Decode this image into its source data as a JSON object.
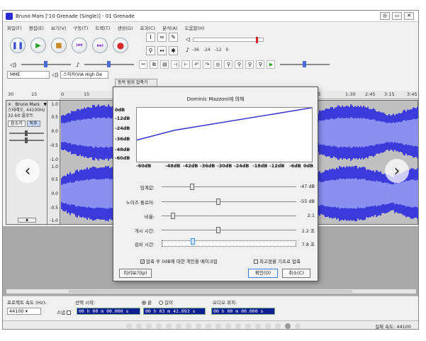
{
  "window": {
    "title": "Bruno Mars ['10 Grenade (Single)] - 01 Grenade",
    "controls": [
      "◎",
      "▭",
      "✕"
    ]
  },
  "menu": [
    "파일(F)",
    "편집(E)",
    "보기(V)",
    "구동(T)",
    "트랙(T)",
    "생성(G)",
    "효과(C)",
    "분석(A)",
    "도움말(H)"
  ],
  "meter_scale": [
    "-36",
    "-24",
    "-12",
    "0"
  ],
  "device_bar": {
    "host": "MME",
    "output": "스피커(VIA High De"
  },
  "timeline": {
    "labels": [
      "30",
      "15",
      "0",
      "15",
      "45",
      "1:30",
      "2:45",
      "3:15",
      "3:45"
    ]
  },
  "track": {
    "name": "Bruno Mars",
    "info_line1": "스테레오, 44100Hz",
    "info_line2": "32-bit 플로트",
    "mute": "음소거",
    "solo": "독주",
    "scale_top": [
      "1.0",
      "0.5",
      "0.0",
      "-0.5",
      "-1.0"
    ],
    "scale_bot": [
      "1.0",
      "0.5",
      "0.0",
      "-0.5",
      "-1.0"
    ]
  },
  "dialog": {
    "tab": "동적 범위 압축기",
    "subtitle": "Dominic Mazzoni에 의해",
    "curve_y_labels": [
      "0dB",
      "-12dB",
      "-24dB",
      "-36dB",
      "-48dB",
      "-60dB"
    ],
    "curve_x_labels": [
      "-60dB",
      "-48dB",
      "-42dB",
      "-36dB",
      "-30dB",
      "-24dB",
      "-18dB",
      "-12dB",
      "-6dB",
      "0dB"
    ],
    "params": [
      {
        "label": "임계값:",
        "value": "-47 dB",
        "pos": 0.22
      },
      {
        "label": "노이즈 플로어:",
        "value": "-55 dB",
        "pos": 0.42
      },
      {
        "label": "비율:",
        "value": "2:1",
        "pos": 0.07
      },
      {
        "label": "개시 시간:",
        "value": "2.2 초",
        "pos": 0.42
      },
      {
        "label": "감쇠 시간:",
        "value": "7.8 초",
        "pos": 0.22
      }
    ],
    "check_makeup": "압축 후 0dB에 대한 게인을 메이크업",
    "check_peaks": "최고점을 기초로 압축",
    "preview_button": "미리보기(p)",
    "ok_button": "확인(O)",
    "cancel_button": "취소(C)"
  },
  "selection_bar": {
    "rate_label": "프로젝트 속도 (Hz):",
    "rate_value": "44100",
    "start_label": "선택 시작:",
    "end_option": "끝",
    "length_option": "길이",
    "snap_label": "스냅",
    "start_value": "00 h 00 m 00.000 s",
    "end_value": "00 h 03 m 42.093 s",
    "audio_pos_label": "오디오 위치:",
    "audio_pos_value": "00 h 00 m 00.000 s"
  },
  "status": {
    "actual_rate": "실제 속도: 44100"
  },
  "carousel": {
    "prev": "‹",
    "next": "›",
    "slides": 18,
    "active_index": 16
  },
  "chart_data": {
    "type": "line",
    "x": [
      -60,
      0
    ],
    "y": [
      -36,
      0
    ],
    "knee_x": -47,
    "knee_y": -25,
    "xlim": [
      -60,
      0
    ],
    "ylim": [
      -60,
      0
    ],
    "xlabel": "",
    "ylabel": "",
    "title": ""
  }
}
